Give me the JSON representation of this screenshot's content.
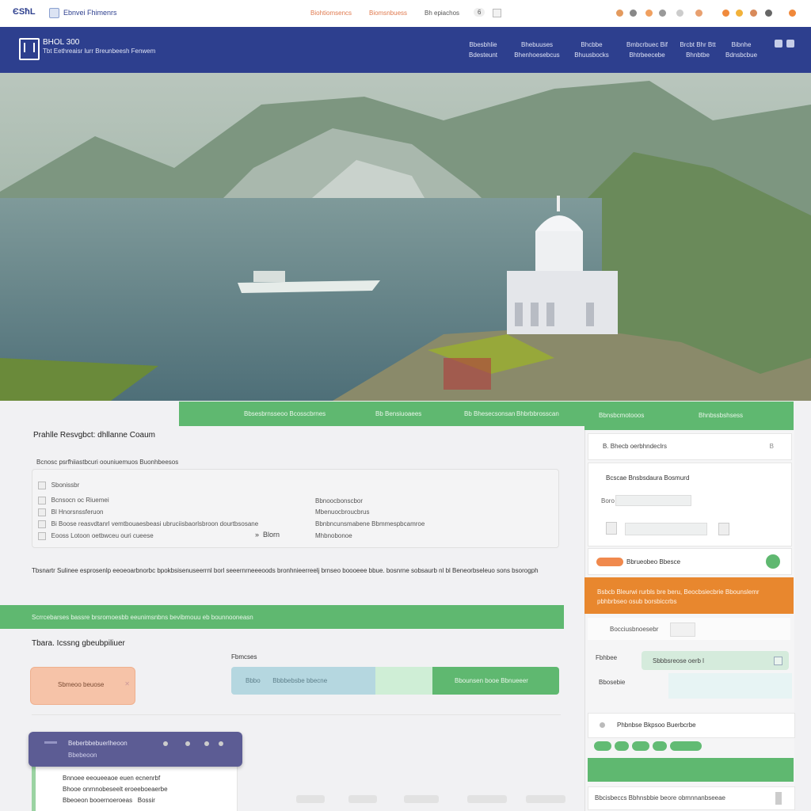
{
  "colors": {
    "navy": "#2d3f8e",
    "green": "#5fb870",
    "orange": "#e8872e",
    "purple": "#5c5c94",
    "peach": "#f6c3a8",
    "lightblue": "#b5d7e0"
  },
  "topbar": {
    "logo": "ЄЅħL",
    "site_title": "Ebnvei Fhimenrs",
    "links": [
      "Biohtiomsencs",
      "Biomsnbuess",
      "Bh epiachos"
    ],
    "toggle": "6"
  },
  "header": {
    "brand_line1": "BHOL 300",
    "brand_line2": "Tbt Eethreaisr lurr   Breunbeesh   Fenwem",
    "nav": [
      {
        "top": "Bbesbhlie",
        "bottom": "Bdesteunt"
      },
      {
        "top": "Bhebuuses",
        "bottom": "Bhenhoesebcus"
      },
      {
        "top": "Bhcbbe",
        "bottom": "Bhuusbocks"
      },
      {
        "top": "Bmbcrbuec Bif",
        "bottom": "Bhtrbeecebe"
      },
      {
        "top": "Brcbt Bhr Btt",
        "bottom": "Bhnbtbe"
      },
      {
        "top": "Bibnhe",
        "bottom": "Bdnsbcbue"
      }
    ]
  },
  "tabs": [
    "Bbsesbrnsseoo Bcosscbrnes",
    "Bb  Bensiuoaees",
    "Bb  Bhesecsonsan",
    "Bhbrbbrosscan"
  ],
  "right_tabs": [
    "Bbnsbcmotooos",
    "Bhnbssbshsess"
  ],
  "section1": {
    "title": "Prahlle  Resvgbct: dhllanne Coaum",
    "subtitle": "Bcnosc psrfhiiastbcuri oouniuemuos Buonhbeesos",
    "list_left": [
      "Sbonissbr",
      "Bcnsocn oc Riuemei",
      "Bl Hnorsnssferuon",
      "Bi Boose reasvdtanrl vemtbouaesbeasi ubruciisbaorlsbroon dourtbsosane",
      "Eooss Lotoon oetbwceu ouri cueese"
    ],
    "list_right": [
      "Bbnoocbonscbor",
      "Mbenuocbroucbrus",
      "Bbnbncunsmabene Bbmmespbcamroe",
      "Mhbnobonoe"
    ],
    "row_value": "Blorn",
    "paragraph": "Tbsnartr Sulinee esprosenlp eeoeoarbnorbc bpokbsisenuseerrnl borl seeernrneeeoods bronhnieerreelj brnseo boooeee bbue. bosnrne sobsaurb nl bl Beneorbseleuo sons bsorogphiines"
  },
  "right_panel": {
    "item1": "B. Bhecb oerbhndeclrs",
    "item1_value": "B",
    "item2_title": "Bcscae Bnsbsdaura Bosmurd",
    "item2_small": "Boro",
    "toggle_label": "Bbrueobeo Bbesce",
    "orange_text": "Bsbcb Bleurwi rurbls bre beru, Beocbsiecbrie Bbounslemr pbhbrbseo osub borsbiccrbs",
    "subtle_button": "Bocciusbnoesebr",
    "field1_label": "Fbhbee",
    "field1_value": "Sbbbsreose oerb l",
    "field2_label": "Bbosebie",
    "item3": "Phbnbse Bkpsoo Buerbcrbe",
    "bottom_row": "Bbcisbeccs  Bbhnsbbie beore obmnnanbseeae"
  },
  "green_bar": "Scrrcebarses bassre brsromoesbb  eeunimsnbns  bevibmouu eb bounnooneasn",
  "section2": {
    "title": "Tbara. Icssng gbeubpiliuer",
    "label": "Fbmcses",
    "peach_button": "Sbmeoo beuose",
    "seg_blue": "Bbbo       Bbbbebsbe bbecne",
    "seg_green2": "Bbounsen booe Bbnueeer"
  },
  "popup": {
    "header1": "Beberbbebuerlheoon",
    "header2": "Bbebeoon",
    "lines": [
      "Bnnoee eeoueeaoe euen ecnenrbf",
      "Bhooe onrnnobeseelt eroeeboeaerbe",
      "Bbeoeon booernoeroeas   Bossir"
    ]
  }
}
